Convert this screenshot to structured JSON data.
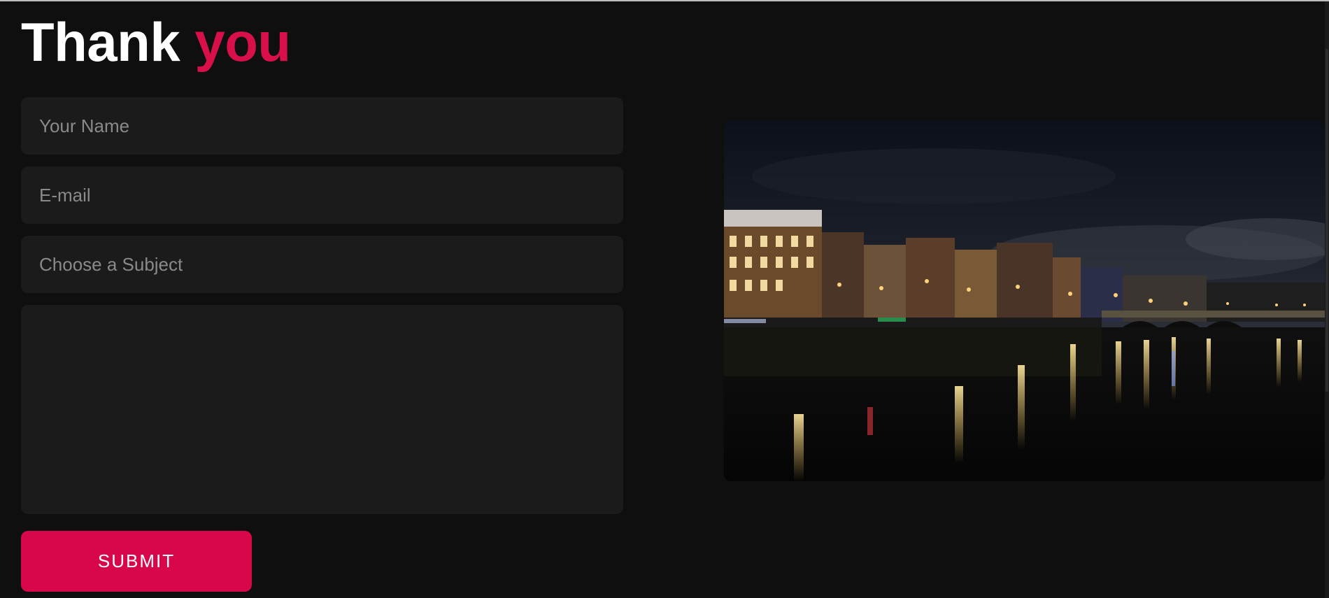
{
  "header": {
    "title_part1": "Thank",
    "title_part2": "you"
  },
  "form": {
    "name_placeholder": "Your Name",
    "email_placeholder": "E-mail",
    "subject_placeholder": "Choose a Subject",
    "message_placeholder": "",
    "submit_label": "SUBMIT"
  },
  "colors": {
    "background": "#0f0f0f",
    "field_background": "#1b1b1b",
    "accent": "#d8074a",
    "title_white": "#ffffff"
  }
}
